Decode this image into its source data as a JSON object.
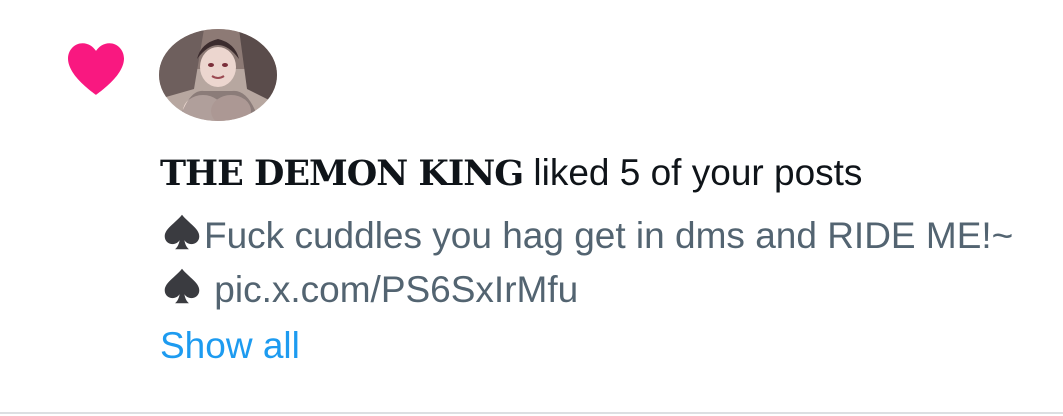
{
  "notification": {
    "type_icon": "heart-icon",
    "avatar_icon": "user-avatar",
    "username": "THE DEMON KING",
    "action_text": " liked 5 of your posts",
    "post": {
      "spade_icon": "spade-emoji",
      "text_part1": "Fuck cuddles you hag get in dms and RIDE ME!~",
      "text_part2": " pic.x.com/PS6SxIrMfu"
    },
    "show_all_label": "Show all"
  },
  "colors": {
    "heart": "#f91880",
    "primary_text": "#0f1419",
    "secondary_text": "#536471",
    "link": "#1d9bf0"
  }
}
